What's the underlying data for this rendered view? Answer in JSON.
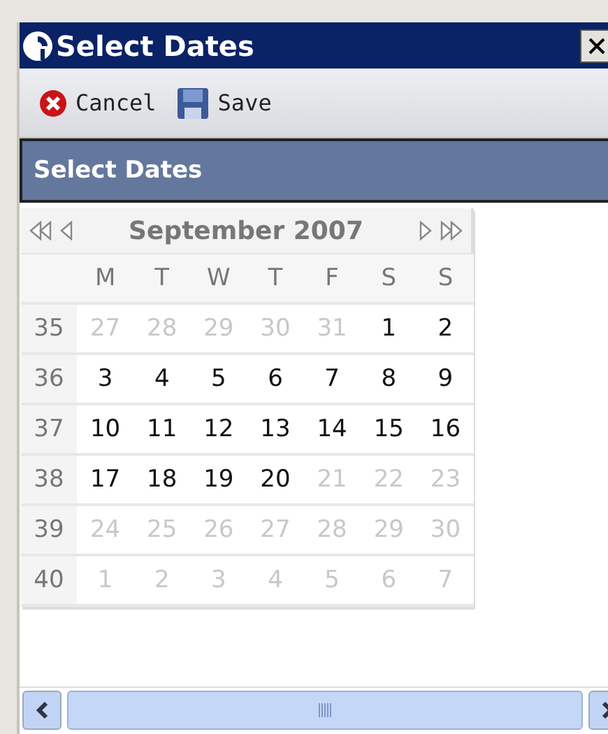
{
  "window": {
    "title": "Select Dates"
  },
  "toolbar": [
    {
      "kind": "cancel",
      "label": "Cancel"
    },
    {
      "kind": "save",
      "label": "Save"
    }
  ],
  "panel": {
    "title": "Select Dates"
  },
  "calendar": {
    "month": "September 2007",
    "weekdays": [
      "M",
      "T",
      "W",
      "T",
      "F",
      "S",
      "S"
    ],
    "weeks": [
      {
        "number": "35",
        "days": [
          {
            "day": "27",
            "muted": true
          },
          {
            "day": "28",
            "muted": true
          },
          {
            "day": "29",
            "muted": true
          },
          {
            "day": "30",
            "muted": true
          },
          {
            "day": "31",
            "muted": true
          },
          {
            "day": "1",
            "muted": false
          },
          {
            "day": "2",
            "muted": false
          }
        ]
      },
      {
        "number": "36",
        "days": [
          {
            "day": "3",
            "muted": false
          },
          {
            "day": "4",
            "muted": false
          },
          {
            "day": "5",
            "muted": false
          },
          {
            "day": "6",
            "muted": false
          },
          {
            "day": "7",
            "muted": false
          },
          {
            "day": "8",
            "muted": false
          },
          {
            "day": "9",
            "muted": false
          }
        ]
      },
      {
        "number": "37",
        "days": [
          {
            "day": "10",
            "muted": false
          },
          {
            "day": "11",
            "muted": false
          },
          {
            "day": "12",
            "muted": false
          },
          {
            "day": "13",
            "muted": false
          },
          {
            "day": "14",
            "muted": false
          },
          {
            "day": "15",
            "muted": false
          },
          {
            "day": "16",
            "muted": false
          }
        ]
      },
      {
        "number": "38",
        "days": [
          {
            "day": "17",
            "muted": false
          },
          {
            "day": "18",
            "muted": false
          },
          {
            "day": "19",
            "muted": false
          },
          {
            "day": "20",
            "muted": false
          },
          {
            "day": "21",
            "muted": true
          },
          {
            "day": "22",
            "muted": true
          },
          {
            "day": "23",
            "muted": true
          }
        ]
      },
      {
        "number": "39",
        "days": [
          {
            "day": "24",
            "muted": true
          },
          {
            "day": "25",
            "muted": true
          },
          {
            "day": "26",
            "muted": true
          },
          {
            "day": "27",
            "muted": true
          },
          {
            "day": "28",
            "muted": true
          },
          {
            "day": "29",
            "muted": true
          },
          {
            "day": "30",
            "muted": true
          }
        ]
      },
      {
        "number": "40",
        "days": [
          {
            "day": "1",
            "muted": true
          },
          {
            "day": "2",
            "muted": true
          },
          {
            "day": "3",
            "muted": true
          },
          {
            "day": "4",
            "muted": true
          },
          {
            "day": "5",
            "muted": true
          },
          {
            "day": "6",
            "muted": true
          },
          {
            "day": "7",
            "muted": true
          }
        ]
      }
    ]
  }
}
